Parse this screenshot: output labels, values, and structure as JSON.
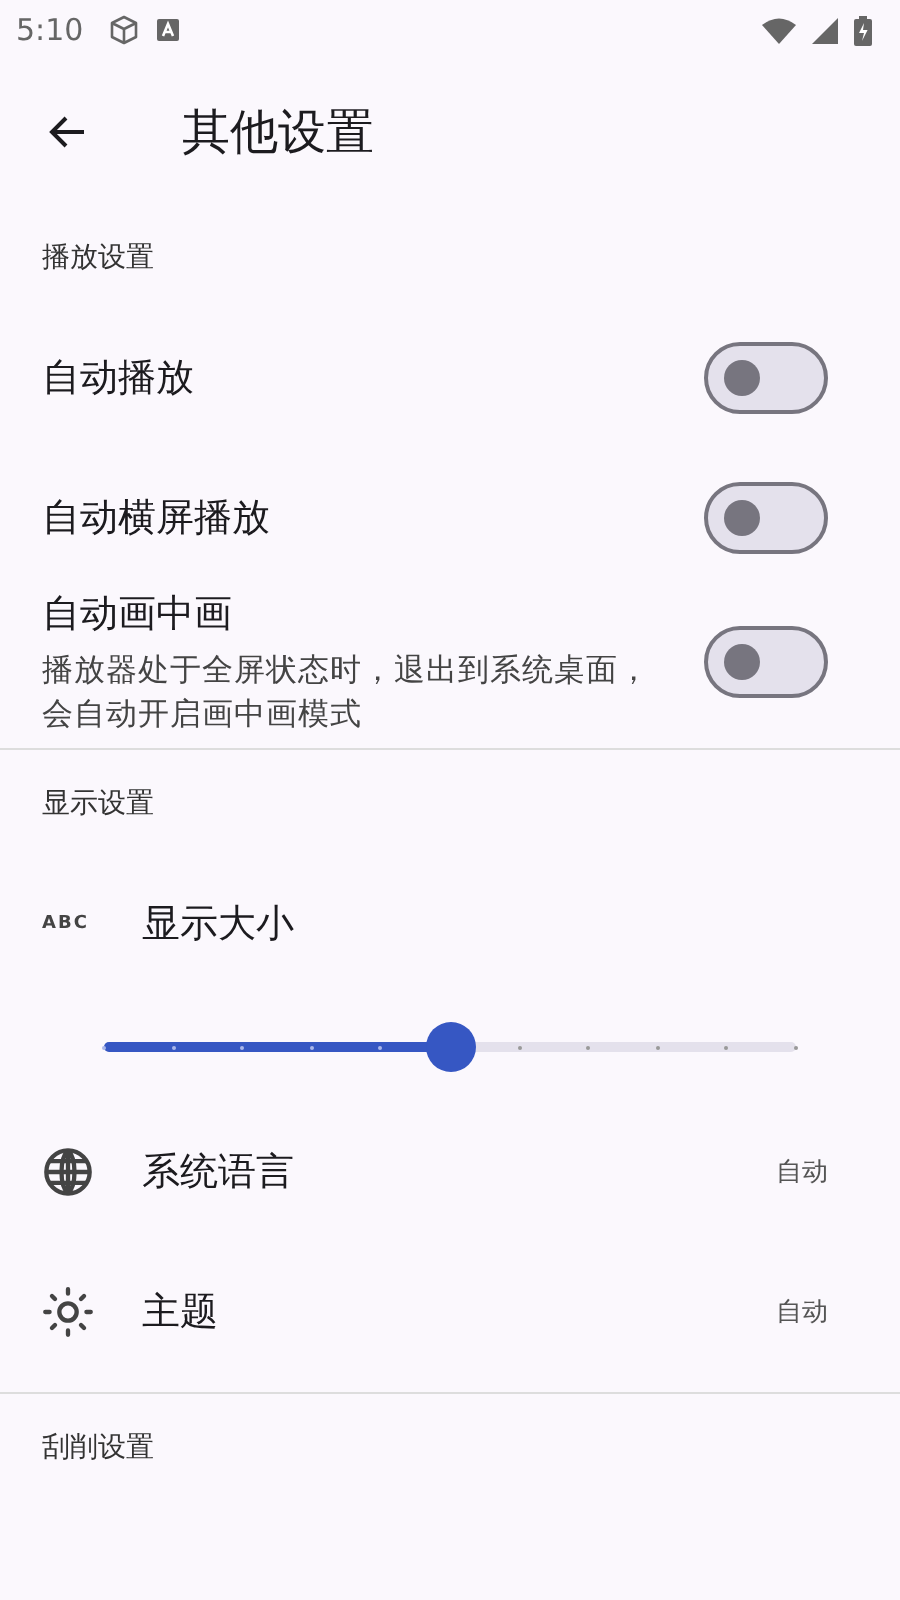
{
  "status_bar": {
    "time": "5:10"
  },
  "app_bar": {
    "title": "其他设置"
  },
  "sections": [
    {
      "title": "播放设置",
      "items": [
        {
          "kind": "switch",
          "label": "自动播放",
          "on": false
        },
        {
          "kind": "switch",
          "label": "自动横屏播放",
          "on": false
        },
        {
          "kind": "switch",
          "label": "自动画中画",
          "description": "播放器处于全屏状态时，退出到系统桌面，会自动开启画中画模式",
          "on": false
        }
      ]
    },
    {
      "title": "显示设置",
      "items": [
        {
          "kind": "text_size",
          "icon_text": "ABC",
          "label": "显示大小",
          "level": 0.5
        },
        {
          "kind": "value",
          "label": "系统语言",
          "value": "自动"
        },
        {
          "kind": "value",
          "label": "主题",
          "value": "自动"
        }
      ]
    },
    {
      "title": "刮削设置"
    }
  ]
}
